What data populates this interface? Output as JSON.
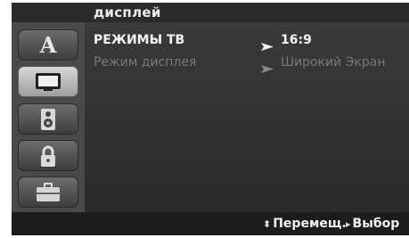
{
  "header": {
    "title": "дисплей"
  },
  "sidebar": {
    "items": [
      {
        "name": "language",
        "icon": "letter-a-icon",
        "text": "A"
      },
      {
        "name": "display",
        "icon": "tv-screen-icon",
        "selected": true
      },
      {
        "name": "audio",
        "icon": "speaker-icon"
      },
      {
        "name": "lock",
        "icon": "padlock-icon"
      },
      {
        "name": "other",
        "icon": "toolbox-icon"
      }
    ]
  },
  "menu": {
    "rows": [
      {
        "label": "РЕЖИМЫ ТВ",
        "value": "16:9",
        "active": true
      },
      {
        "label": "Режим дисплея",
        "value": "Широкий Экран",
        "active": false
      }
    ]
  },
  "footer": {
    "move_glyph": "⬍",
    "move_label": "Перемещ.",
    "select_glyph": "▸",
    "select_label": "Выбор"
  }
}
